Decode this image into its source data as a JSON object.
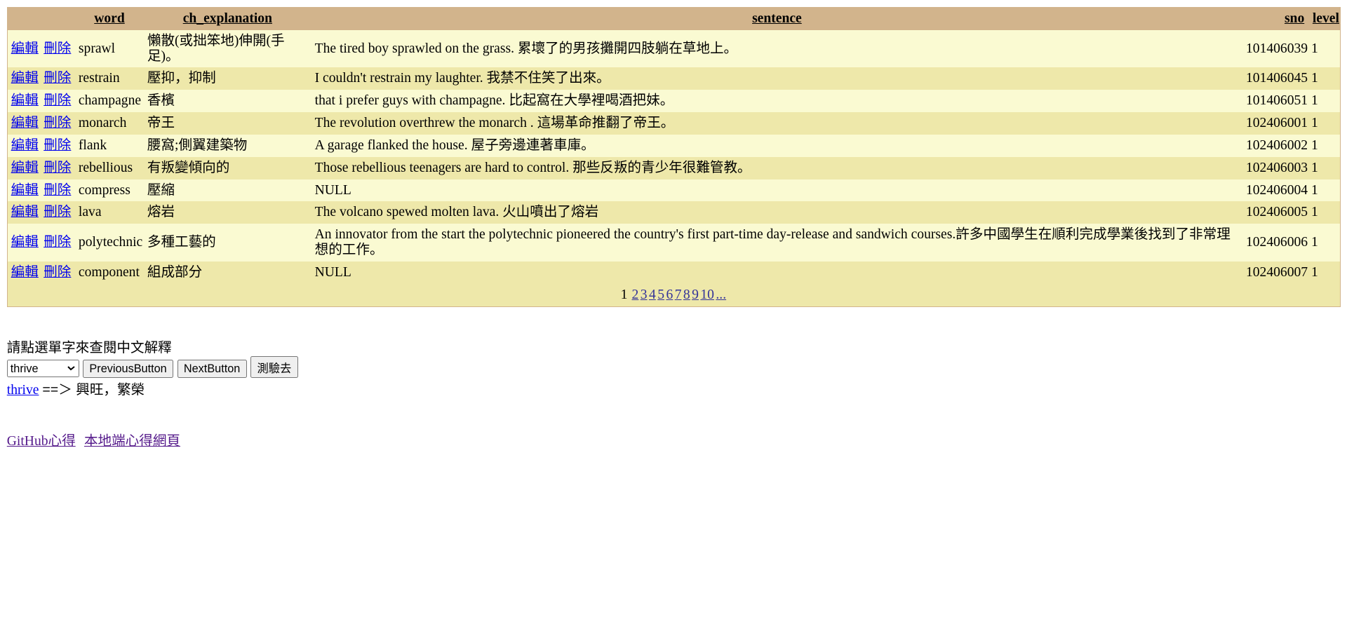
{
  "table": {
    "headers": [
      "",
      "word",
      "ch_explanation",
      "sentence",
      "sno",
      "level"
    ],
    "edit_label": "編輯",
    "delete_label": "刪除",
    "rows": [
      {
        "word": "sprawl",
        "ch": "懶散(或拙笨地)伸開(手足)。",
        "sentence": "The tired boy sprawled on the grass. 累壞了的男孩攤開四肢躺在草地上。",
        "sno": "101406039",
        "level": "1"
      },
      {
        "word": "restrain",
        "ch": "壓抑，抑制",
        "sentence": "I couldn't restrain my laughter. 我禁不住笑了出來。",
        "sno": "101406045",
        "level": "1"
      },
      {
        "word": "champagne",
        "ch": "香檳",
        "sentence": "that i prefer guys with champagne. 比起窩在大學裡喝酒把妹。",
        "sno": "101406051",
        "level": "1"
      },
      {
        "word": "monarch",
        "ch": "帝王",
        "sentence": "The revolution overthrew the monarch . 這場革命推翻了帝王。",
        "sno": "102406001",
        "level": "1"
      },
      {
        "word": "flank",
        "ch": "腰窩;側翼建築物",
        "sentence": "A garage flanked the house. 屋子旁邊連著車庫。",
        "sno": "102406002",
        "level": "1"
      },
      {
        "word": "rebellious",
        "ch": "有叛變傾向的",
        "sentence": "Those rebellious teenagers are hard to control. 那些反叛的青少年很難管教。",
        "sno": "102406003",
        "level": "1"
      },
      {
        "word": "compress",
        "ch": "壓縮",
        "sentence": "NULL",
        "sno": "102406004",
        "level": "1"
      },
      {
        "word": "lava",
        "ch": "熔岩",
        "sentence": "The volcano spewed molten lava. 火山噴出了熔岩",
        "sno": "102406005",
        "level": "1"
      },
      {
        "word": "polytechnic",
        "ch": "多種工藝的",
        "sentence": "An innovator from the start the polytechnic pioneered the country's first part-time day-release and sandwich courses.許多中國學生在順利完成學業後找到了非常理想的工作。",
        "sno": "102406006",
        "level": "1"
      },
      {
        "word": "component",
        "ch": "組成部分",
        "sentence": "NULL",
        "sno": "102406007",
        "level": "1"
      }
    ],
    "pager": {
      "current": "1",
      "pages": [
        "2",
        "3",
        "4",
        "5",
        "6",
        "7",
        "8",
        "9",
        "10",
        "..."
      ]
    }
  },
  "lookup": {
    "instruction": "請點選單字來查閱中文解釋",
    "selected_word": "thrive",
    "prev_label": "PreviousButton",
    "next_label": "NextButton",
    "quiz_label": "測驗去",
    "result_word": "thrive",
    "result_text": "==＞ 興旺，繁榮"
  },
  "footer_links": [
    "GitHub心得",
    "本地端心得網頁"
  ],
  "colors": {
    "header": "#D2B48C",
    "row_odd": "#FAFAD2",
    "row_even": "#EEE8AA"
  }
}
